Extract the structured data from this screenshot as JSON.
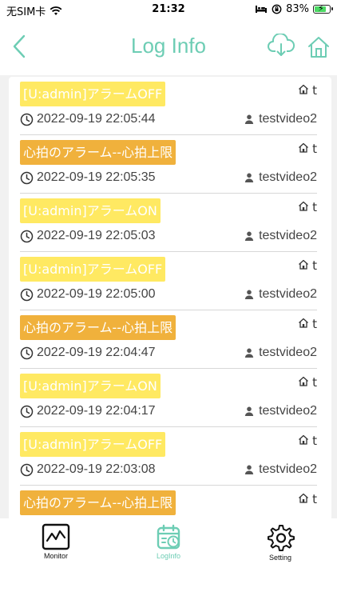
{
  "status_bar": {
    "carrier": "无SIM卡",
    "time": "21:32",
    "battery": "83%",
    "battery_level": 0.83
  },
  "header": {
    "title": "Log Info",
    "back_icon": "chevron-left-icon",
    "cloud_icon": "cloud-download-icon",
    "home_icon": "home-icon"
  },
  "colors": {
    "accent": "#6dcdb4",
    "tag_yellow": "#ffe962",
    "tag_orange": "#f0b13c"
  },
  "logs": [
    {
      "message": "[U:admin]アラームOFF",
      "color": "yellow",
      "home_label": "t",
      "timestamp": "2022-09-19 22:05:44",
      "user": "testvideo2"
    },
    {
      "message": "心拍のアラーム--心拍上限",
      "color": "orange",
      "home_label": "t",
      "timestamp": "2022-09-19 22:05:35",
      "user": "testvideo2"
    },
    {
      "message": "[U:admin]アラームON",
      "color": "yellow",
      "home_label": "t",
      "timestamp": "2022-09-19 22:05:03",
      "user": "testvideo2"
    },
    {
      "message": "[U:admin]アラームOFF",
      "color": "yellow",
      "home_label": "t",
      "timestamp": "2022-09-19 22:05:00",
      "user": "testvideo2"
    },
    {
      "message": "心拍のアラーム--心拍上限",
      "color": "orange",
      "home_label": "t",
      "timestamp": "2022-09-19 22:04:47",
      "user": "testvideo2"
    },
    {
      "message": "[U:admin]アラームON",
      "color": "yellow",
      "home_label": "t",
      "timestamp": "2022-09-19 22:04:17",
      "user": "testvideo2"
    },
    {
      "message": "[U:admin]アラームOFF",
      "color": "yellow",
      "home_label": "t",
      "timestamp": "2022-09-19 22:03:08",
      "user": "testvideo2"
    },
    {
      "message": "心拍のアラーム--心拍上限",
      "color": "orange",
      "home_label": "t",
      "timestamp": "",
      "user": ""
    }
  ],
  "tabs": [
    {
      "label": "Monitor",
      "icon": "monitor-icon",
      "active": false
    },
    {
      "label": "LogInfo",
      "icon": "calendar-icon",
      "active": true
    },
    {
      "label": "Setting",
      "icon": "gear-icon",
      "active": false
    }
  ]
}
